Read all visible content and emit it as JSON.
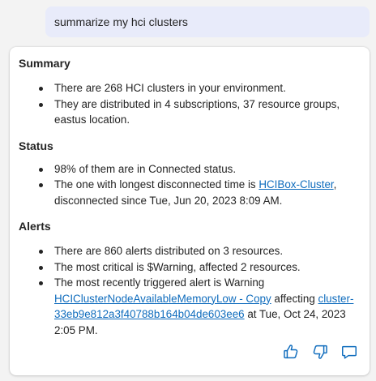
{
  "user_message": "summarize my hci clusters",
  "summary": {
    "heading": "Summary",
    "items": [
      "There are 268 HCI clusters in your environment.",
      "They are distributed in 4 subscriptions, 37 resource groups, eastus location."
    ]
  },
  "status": {
    "heading": "Status",
    "item1": "98% of them are in Connected status.",
    "item2_prefix": "The one with longest disconnected time is ",
    "item2_link": "HCIBox-Cluster",
    "item2_suffix": ", disconnected since Tue, Jun 20, 2023 8:09 AM."
  },
  "alerts": {
    "heading": "Alerts",
    "item1": "There are 860 alerts distributed on 3 resources.",
    "item2": "The most critical is $Warning, affected 2 resources.",
    "item3_prefix": "The most recently triggered alert is Warning ",
    "item3_link1": "HCIClusterNodeAvailableMemoryLow - Copy",
    "item3_mid": " affecting ",
    "item3_link2": "cluster-33eb9e812a3f40788b164b04de603ee6",
    "item3_suffix": " at Tue, Oct 24, 2023 2:05 PM."
  },
  "actions": {
    "thumbs_up_icon": "thumbs-up-icon",
    "thumbs_down_icon": "thumbs-down-icon",
    "comment_icon": "comment-icon"
  },
  "colors": {
    "user_bubble": "#e8ebfa",
    "link": "#0f6cbd",
    "icon": "#0f6cbd"
  }
}
